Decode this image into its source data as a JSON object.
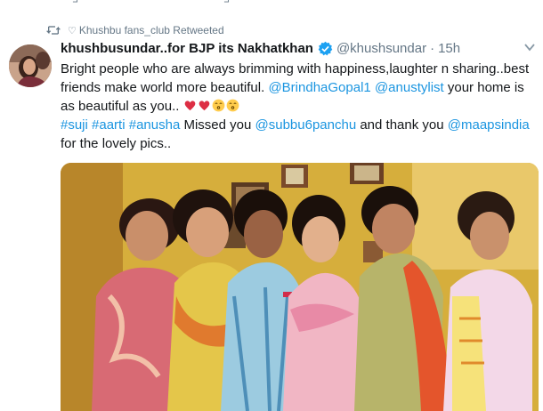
{
  "retweet_context": {
    "heart_glyph": "♡",
    "text": "Khushbu fans_club Retweeted"
  },
  "tweet": {
    "display_name": "khushbusundar..for BJP its Nakhatkhan",
    "handle": "@khushsundar",
    "separator": "·",
    "time": "15h",
    "text": {
      "line1": "Bright people who are always brimming with happiness,laughter n sharing..best friends make world more beautiful.",
      "mention1": "@BrindhaGopal1",
      "mention2": "@anustylist",
      "after_mentions": "your home is as beautiful as you..",
      "hashtag1": "#suji",
      "hashtag2": "#aarti",
      "hashtag3": "#anusha",
      "missed": "Missed you",
      "mention3": "@subbu6panchu",
      "thank": "and thank you",
      "mention4": "@maapsindia",
      "ending": "for the lovely pics.."
    },
    "emoji": [
      "heart-red",
      "heart-red",
      "kissing-face",
      "kissing-face"
    ]
  },
  "colors": {
    "link": "#1b95e0",
    "secondary_text": "#657786",
    "verified": "#1da1f2",
    "heart": "#e0245e"
  }
}
